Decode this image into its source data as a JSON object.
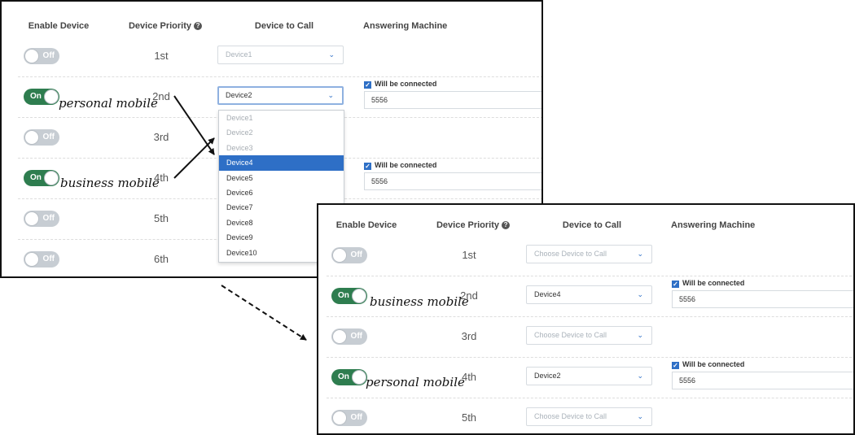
{
  "headers": {
    "enable_device": "Enable Device",
    "device_priority": "Device Priority",
    "priority_help_icon": "?",
    "device_to_call": "Device to Call",
    "answering_machine": "Answering Machine"
  },
  "panel_before": {
    "rows": [
      {
        "toggle": "Off",
        "priority": "1st",
        "device": "Device1"
      },
      {
        "toggle": "On",
        "priority": "2nd",
        "device": "Device2",
        "annotation": "personal mobile",
        "am_check": "Will be connected",
        "am_value": "5556"
      },
      {
        "toggle": "Off",
        "priority": "3rd"
      },
      {
        "toggle": "On",
        "priority": "4th",
        "annotation": "business mobile",
        "am_check": "Will be connected",
        "am_value": "5556"
      },
      {
        "toggle": "Off",
        "priority": "5th"
      },
      {
        "toggle": "Off",
        "priority": "6th"
      }
    ],
    "dropdown_options": [
      "Device1",
      "Device2",
      "Device3",
      "Device4",
      "Device5",
      "Device6",
      "Device7",
      "Device8",
      "Device9",
      "Device10"
    ],
    "dropdown_highlighted": "Device4"
  },
  "panel_after": {
    "rows": [
      {
        "toggle": "Off",
        "priority": "1st",
        "device": "Choose Device to Call"
      },
      {
        "toggle": "On",
        "priority": "2nd",
        "device": "Device4",
        "annotation": "business mobile",
        "am_check": "Will be connected",
        "am_value": "5556"
      },
      {
        "toggle": "Off",
        "priority": "3rd",
        "device": "Choose Device to Call"
      },
      {
        "toggle": "On",
        "priority": "4th",
        "device": "Device2",
        "annotation": "personal mobile",
        "am_check": "Will be connected",
        "am_value": "5556"
      },
      {
        "toggle": "Off",
        "priority": "5th",
        "device": "Choose Device to Call"
      }
    ]
  },
  "icons": {
    "chevron": "chevron-down-icon",
    "checkbox": "checkbox-checked-icon",
    "arrows": "annotation-arrow-icon"
  },
  "colors": {
    "toggle_on": "#2e7d4f",
    "toggle_off": "#c7cdd3",
    "accent": "#2e6fc6"
  }
}
